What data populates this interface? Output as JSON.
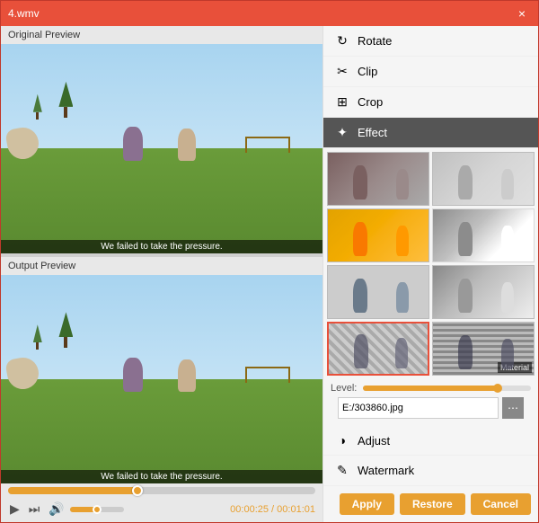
{
  "window": {
    "title": "4.wmv",
    "close_label": "×"
  },
  "left_panel": {
    "original_label": "Original Preview",
    "output_label": "Output Preview",
    "subtitle": "We failed to take the pressure.",
    "time_current": "00:00:25",
    "time_total": "00:01:01",
    "time_separator": " / "
  },
  "right_panel": {
    "menu_items": [
      {
        "id": "rotate",
        "label": "Rotate",
        "icon": "↻"
      },
      {
        "id": "clip",
        "label": "Clip",
        "icon": "✂"
      },
      {
        "id": "crop",
        "label": "Crop",
        "icon": "⊞"
      },
      {
        "id": "effect",
        "label": "Effect",
        "icon": "✦",
        "active": true
      }
    ],
    "effect_thumbs": [
      {
        "id": 1,
        "label": "",
        "style": "effect-1"
      },
      {
        "id": 2,
        "label": "",
        "style": "effect-2"
      },
      {
        "id": 3,
        "label": "",
        "style": "effect-3"
      },
      {
        "id": 4,
        "label": "",
        "style": "effect-4"
      },
      {
        "id": 5,
        "label": "",
        "style": "effect-5"
      },
      {
        "id": 6,
        "label": "",
        "style": "effect-6"
      },
      {
        "id": 7,
        "label": "",
        "style": "effect-7",
        "selected": true
      },
      {
        "id": 8,
        "label": "Material",
        "style": "effect-8"
      }
    ],
    "level_label": "Level:",
    "file_path": "E:/303860.jpg",
    "browse_icon": "⋯",
    "bottom_menu": [
      {
        "id": "adjust",
        "label": "Adjust",
        "icon": "◑"
      },
      {
        "id": "watermark",
        "label": "Watermark",
        "icon": "✎"
      }
    ],
    "buttons": {
      "apply": "Apply",
      "restore": "Restore",
      "cancel": "Cancel"
    }
  }
}
